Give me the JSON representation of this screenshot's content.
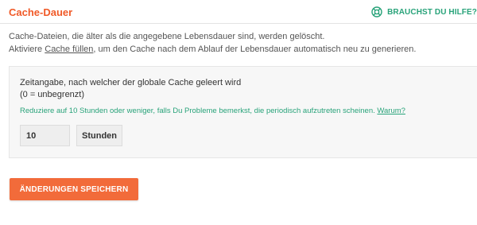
{
  "header": {
    "title": "Cache-Dauer",
    "help_label": "BRAUCHST DU HILFE?",
    "help_icon": "lifebuoy-icon"
  },
  "description": {
    "line1": "Cache-Dateien, die älter als die angegebene Lebensdauer sind, werden gelöscht.",
    "line2_before": "Aktiviere ",
    "line2_link": "Cache füllen",
    "line2_after": ", um den Cache nach dem Ablauf der Lebensdauer automatisch neu zu generieren."
  },
  "lifetime": {
    "label_line1": "Zeitangabe, nach welcher der globale Cache geleert wird",
    "label_line2": "(0 = unbegrenzt)",
    "hint_text": "Reduziere auf 10 Stunden oder weniger, falls Du Probleme bemerkst, die periodisch aufzutreten scheinen. ",
    "hint_link": "Warum?",
    "value": "10",
    "unit": "Stunden"
  },
  "actions": {
    "save_label": "ÄNDERUNGEN SPEICHERN"
  },
  "colors": {
    "accent": "#f05a28",
    "button": "#f26b3a",
    "help_green": "#29a37a"
  }
}
